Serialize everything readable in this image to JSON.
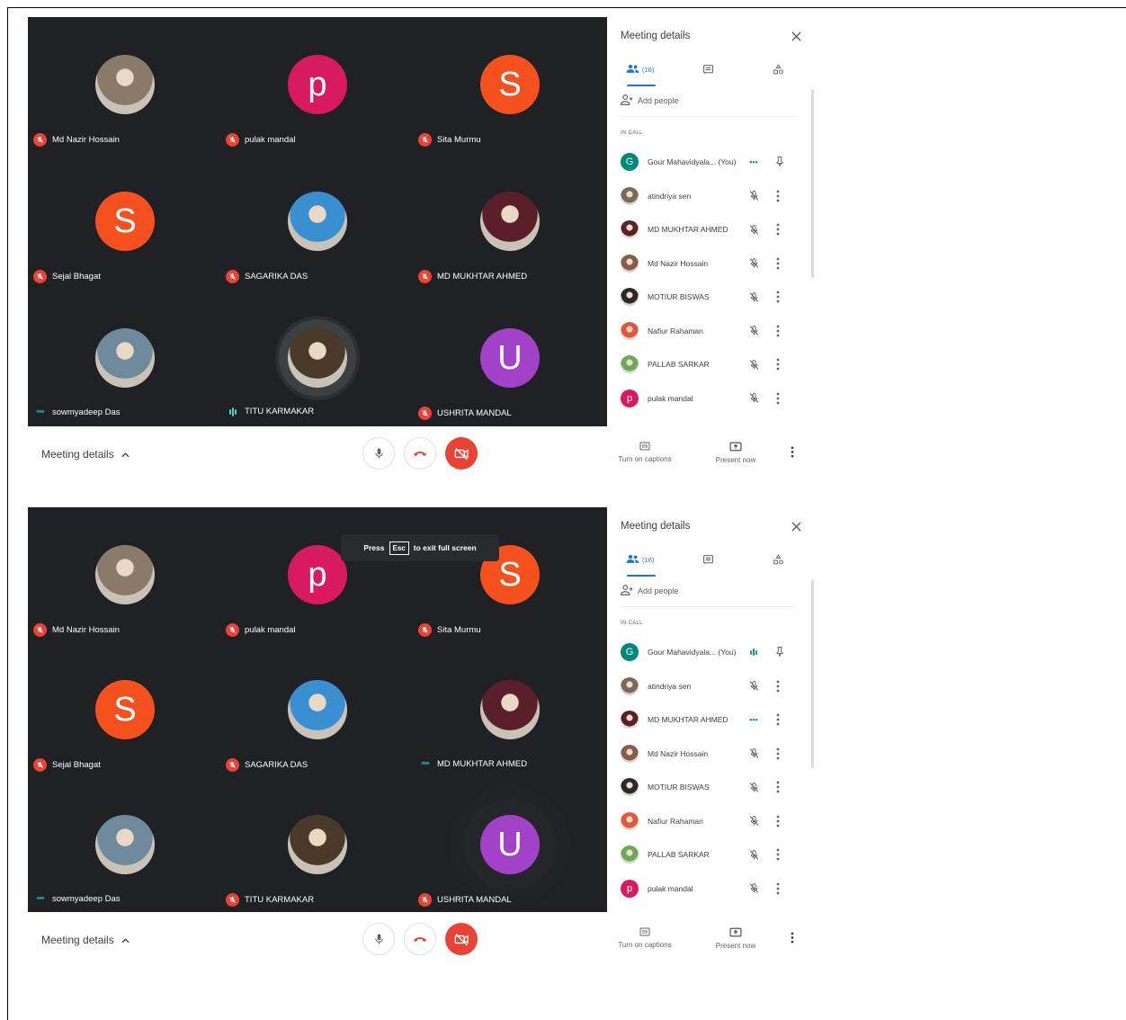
{
  "screenshots": [
    {
      "tiles": [
        {
          "name": "Md Nazir Hossain",
          "avatar_type": "photo",
          "avatar_color": "#8a7a6a",
          "indicator": "mic-off"
        },
        {
          "name": "pulak mandal",
          "avatar_type": "letter",
          "letter": "p",
          "avatar_color": "#d81b60",
          "indicator": "mic-off"
        },
        {
          "name": "Sita Murmu",
          "avatar_type": "letter",
          "letter": "S",
          "avatar_color": "#f4511e",
          "indicator": "mic-off"
        },
        {
          "name": "Sejal Bhagat",
          "avatar_type": "letter",
          "letter": "S",
          "avatar_color": "#f4511e",
          "indicator": "mic-off"
        },
        {
          "name": "SAGARIKA DAS",
          "avatar_type": "photo",
          "avatar_color": "#3a8fd0",
          "indicator": "mic-off"
        },
        {
          "name": "MD MUKHTAR AHMED",
          "avatar_type": "photo",
          "avatar_color": "#5a1f2a",
          "indicator": "mic-off"
        },
        {
          "name": "sowmyadeep Das",
          "avatar_type": "photo",
          "avatar_color": "#6f8a9a",
          "indicator": "dots"
        },
        {
          "name": "TITU KARMAKAR",
          "avatar_type": "photo",
          "avatar_color": "#4a3a2a",
          "indicator": "wave",
          "speaking": true
        },
        {
          "name": "USHRITA MANDAL",
          "avatar_type": "letter",
          "letter": "U",
          "avatar_color": "#a142c9",
          "indicator": "mic-off"
        }
      ],
      "esc_hint": null,
      "panel": {
        "title": "Meeting details",
        "people_tab_count": "(16)",
        "add_people": "Add people",
        "in_call_label": "IN CALL",
        "participants": [
          {
            "name": "Gour Mahavidyala... (You)",
            "avatar_type": "letter",
            "letter": "G",
            "color": "#00897b",
            "status": "dots",
            "action": "pin"
          },
          {
            "name": "atindriya sen",
            "avatar_type": "photo",
            "color": "#7a6a5a",
            "status": "mic-off",
            "action": "more"
          },
          {
            "name": "MD MUKHTAR AHMED",
            "avatar_type": "photo",
            "color": "#5a1f2a",
            "status": "mic-off",
            "action": "more"
          },
          {
            "name": "Md Nazir Hossain",
            "avatar_type": "photo",
            "color": "#8a5a4a",
            "status": "mic-off",
            "action": "more"
          },
          {
            "name": "MOTIUR BISWAS",
            "avatar_type": "photo",
            "color": "#2a2a2a",
            "status": "mic-off",
            "action": "more"
          },
          {
            "name": "Nafiur Rahaman",
            "avatar_type": "photo",
            "color": "#e05a3a",
            "status": "mic-off",
            "action": "more"
          },
          {
            "name": "PALLAB SARKAR",
            "avatar_type": "photo",
            "color": "#6aaa5a",
            "status": "mic-off",
            "action": "more"
          },
          {
            "name": "pulak mandal",
            "avatar_type": "letter",
            "letter": "p",
            "color": "#d81b60",
            "status": "mic-off",
            "action": "more"
          }
        ]
      },
      "bottom": {
        "meeting_details": "Meeting details",
        "captions": "Turn on captions",
        "present": "Present now"
      }
    },
    {
      "tiles": [
        {
          "name": "Md Nazir Hossain",
          "avatar_type": "photo",
          "avatar_color": "#8a7a6a",
          "indicator": "mic-off"
        },
        {
          "name": "pulak mandal",
          "avatar_type": "letter",
          "letter": "p",
          "avatar_color": "#d81b60",
          "indicator": "mic-off"
        },
        {
          "name": "Sita Murmu",
          "avatar_type": "letter",
          "letter": "S",
          "avatar_color": "#f4511e",
          "indicator": "mic-off"
        },
        {
          "name": "Sejal Bhagat",
          "avatar_type": "letter",
          "letter": "S",
          "avatar_color": "#f4511e",
          "indicator": "mic-off"
        },
        {
          "name": "SAGARIKA DAS",
          "avatar_type": "photo",
          "avatar_color": "#3a8fd0",
          "indicator": "mic-off"
        },
        {
          "name": "MD MUKHTAR AHMED",
          "avatar_type": "photo",
          "avatar_color": "#5a1f2a",
          "indicator": "dots"
        },
        {
          "name": "sowmyadeep Das",
          "avatar_type": "photo",
          "avatar_color": "#6f8a9a",
          "indicator": "dots"
        },
        {
          "name": "TITU KARMAKAR",
          "avatar_type": "photo",
          "avatar_color": "#4a3a2a",
          "indicator": "mic-off"
        },
        {
          "name": "USHRITA MANDAL",
          "avatar_type": "letter",
          "letter": "U",
          "avatar_color": "#a142c9",
          "indicator": "mic-off",
          "ring": true
        }
      ],
      "esc_hint": {
        "pre": "Press",
        "key": "Esc",
        "post": "to exit full screen"
      },
      "panel": {
        "title": "Meeting details",
        "people_tab_count": "(16)",
        "add_people": "Add people",
        "in_call_label": "IN CALL",
        "participants": [
          {
            "name": "Gour Mahavidyala... (You)",
            "avatar_type": "letter",
            "letter": "G",
            "color": "#00897b",
            "status": "wave",
            "action": "pin"
          },
          {
            "name": "atindriya sen",
            "avatar_type": "photo",
            "color": "#7a6a5a",
            "status": "mic-off",
            "action": "more"
          },
          {
            "name": "MD MUKHTAR AHMED",
            "avatar_type": "photo",
            "color": "#5a1f2a",
            "status": "dots",
            "action": "more"
          },
          {
            "name": "Md Nazir Hossain",
            "avatar_type": "photo",
            "color": "#8a5a4a",
            "status": "mic-off",
            "action": "more"
          },
          {
            "name": "MOTIUR BISWAS",
            "avatar_type": "photo",
            "color": "#2a2a2a",
            "status": "mic-off",
            "action": "more"
          },
          {
            "name": "Nafiur Rahaman",
            "avatar_type": "photo",
            "color": "#e05a3a",
            "status": "mic-off",
            "action": "more"
          },
          {
            "name": "PALLAB SARKAR",
            "avatar_type": "photo",
            "color": "#6aaa5a",
            "status": "mic-off",
            "action": "more"
          },
          {
            "name": "pulak mandal",
            "avatar_type": "letter",
            "letter": "p",
            "color": "#d81b60",
            "status": "mic-off",
            "action": "more"
          }
        ]
      },
      "bottom": {
        "meeting_details": "Meeting details",
        "captions": "Turn on captions",
        "present": "Present now"
      }
    }
  ],
  "colors": {
    "accent": "#1a73e8",
    "danger": "#ea4335",
    "grid_bg": "#202124"
  }
}
